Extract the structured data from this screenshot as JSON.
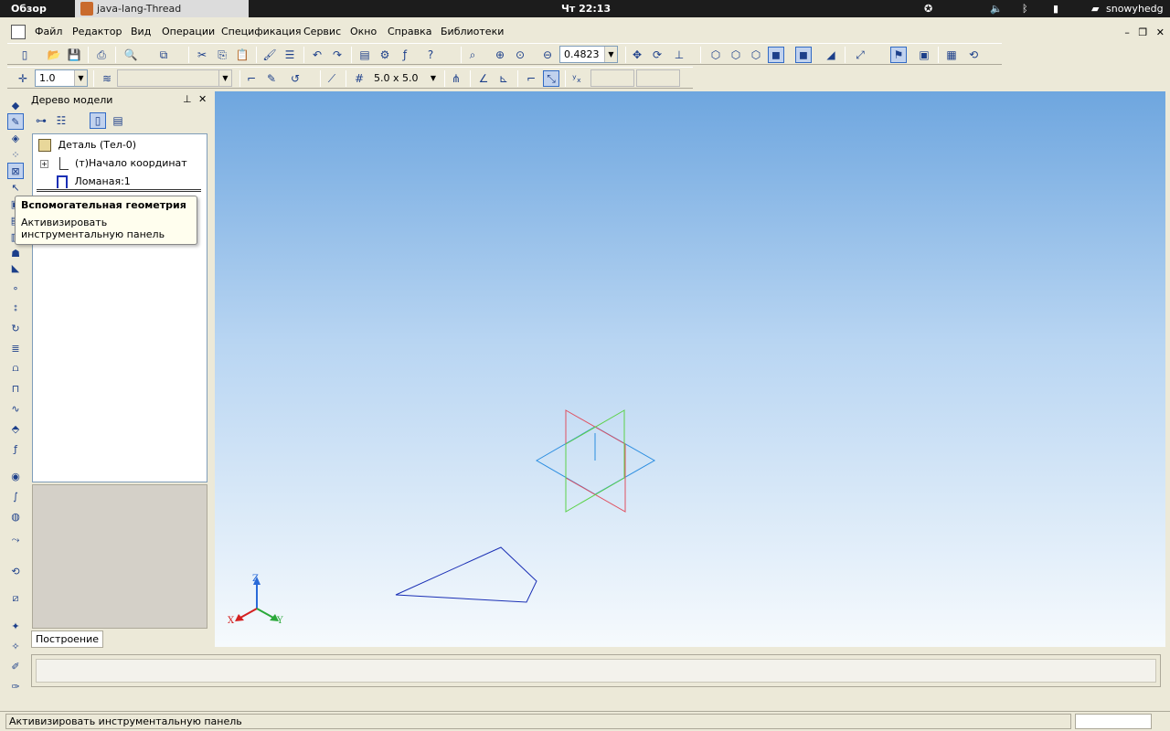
{
  "topbar": {
    "overview": "Обзор",
    "task_title": "java-lang-Thread",
    "clock": "Чт 22:13",
    "username": "snowyhedg",
    "icons": [
      "accessibility-icon",
      "volume-icon",
      "bluetooth-icon",
      "battery-icon",
      "user-icon"
    ]
  },
  "menubar": {
    "items": [
      "Файл",
      "Редактор",
      "Вид",
      "Операции",
      "Спецификация",
      "Сервис",
      "Окно",
      "Справка",
      "Библиотеки"
    ]
  },
  "toolbar1": {
    "zoom_value": "0.4823"
  },
  "toolbar2": {
    "step_value": "1.0",
    "grid_value": "5.0 x 5.0"
  },
  "tree": {
    "title": "Дерево модели",
    "root": "Деталь (Тел-0)",
    "children": [
      "(т)Начало координат",
      "Ломаная:1"
    ],
    "tab": "Построение"
  },
  "tooltip": {
    "title": "Вспомогательная геометрия",
    "text": "Активизировать инструментальную панель"
  },
  "axes": {
    "z": "Z",
    "x": "X",
    "y": "Y"
  },
  "statusbar": {
    "message": "Активизировать инструментальную панель"
  },
  "colors": {
    "viewport_top": "#6ea6df",
    "viewport_bottom": "#f6fafd",
    "polyline": "#1a2fb5",
    "plane_xy": "#2a8de0",
    "plane_red": "#e05060",
    "plane_green": "#5cd24a"
  }
}
